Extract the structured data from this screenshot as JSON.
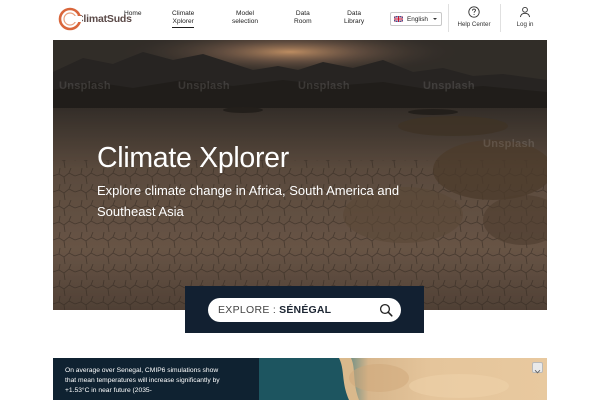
{
  "brand": {
    "name": "ClimatSuds"
  },
  "nav": {
    "links": [
      {
        "line1": "Home",
        "line2": ""
      },
      {
        "line1": "Climate",
        "line2": "Xplorer"
      },
      {
        "line1": "Model",
        "line2": "selection"
      },
      {
        "line1": "Data",
        "line2": "Room"
      },
      {
        "line1": "Data",
        "line2": "Library"
      }
    ],
    "active_index": 1,
    "language": "English",
    "help_label": "Help Center",
    "login_label": "Log in"
  },
  "hero": {
    "title": "Climate Xplorer",
    "subtitle": "Explore climate change in Africa, South America and Southeast Asia",
    "watermark": "Unsplash"
  },
  "explore": {
    "prefix": "EXPLORE :",
    "country": "SÉNÉGAL"
  },
  "summary": {
    "text": "On average over Senegal, CMIP6 simulations show that mean temperatures will increase significantly by +1.53°C in near future (2035-"
  },
  "colors": {
    "navy": "#122031",
    "logo_orange": "#d9663b",
    "text_dark": "#1d1d1d"
  }
}
